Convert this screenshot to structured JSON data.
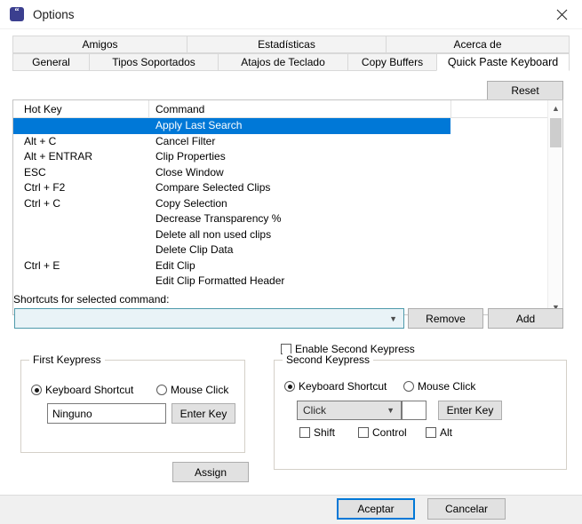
{
  "window": {
    "title": "Options",
    "icon": "app-quote-icon",
    "close_label": "✕"
  },
  "tabs": {
    "row1": [
      {
        "label": "Amigos",
        "selected": false
      },
      {
        "label": "Estadísticas",
        "selected": false
      },
      {
        "label": "Acerca de",
        "selected": false
      }
    ],
    "row2": [
      {
        "label": "General",
        "selected": false
      },
      {
        "label": "Tipos Soportados",
        "selected": false
      },
      {
        "label": "Atajos de Teclado",
        "selected": false
      },
      {
        "label": "Copy Buffers",
        "selected": false
      },
      {
        "label": "Quick Paste Keyboard",
        "selected": true
      }
    ]
  },
  "toolbar": {
    "reset_label": "Reset"
  },
  "list": {
    "columns": [
      "Hot Key",
      "Command"
    ],
    "rows": [
      {
        "hotkey": "",
        "command": "Apply Last Search",
        "selected": true
      },
      {
        "hotkey": "Alt + C",
        "command": "Cancel Filter",
        "selected": false
      },
      {
        "hotkey": "Alt + ENTRAR",
        "command": "Clip Properties",
        "selected": false
      },
      {
        "hotkey": "ESC",
        "command": "Close Window",
        "selected": false
      },
      {
        "hotkey": "Ctrl + F2",
        "command": "Compare Selected Clips",
        "selected": false
      },
      {
        "hotkey": "Ctrl + C",
        "command": "Copy Selection",
        "selected": false
      },
      {
        "hotkey": "",
        "command": "Decrease Transparency %",
        "selected": false
      },
      {
        "hotkey": "",
        "command": "Delete all non used clips",
        "selected": false
      },
      {
        "hotkey": "",
        "command": "Delete Clip Data",
        "selected": false
      },
      {
        "hotkey": "Ctrl + E",
        "command": "Edit Clip",
        "selected": false
      },
      {
        "hotkey": "",
        "command": "Edit Clip Formatted Header",
        "selected": false
      }
    ]
  },
  "shortcuts": {
    "label": "Shortcuts for selected command:",
    "combo_value": "",
    "remove_label": "Remove",
    "add_label": "Add"
  },
  "enable_second": {
    "label": "Enable Second Keypress",
    "checked": false
  },
  "first_keypress": {
    "title": "First Keypress",
    "keyboard_label": "Keyboard Shortcut",
    "mouse_label": "Mouse Click",
    "selected_mode": "keyboard",
    "key_value": "Ninguno",
    "enter_key_label": "Enter Key"
  },
  "second_keypress": {
    "title": "Second Keypress",
    "keyboard_label": "Keyboard Shortcut",
    "mouse_label": "Mouse Click",
    "selected_mode": "keyboard",
    "combo_value": "Click",
    "extra_value": "",
    "enter_key_label": "Enter Key",
    "modifiers": [
      {
        "label": "Shift",
        "checked": false
      },
      {
        "label": "Control",
        "checked": false
      },
      {
        "label": "Alt",
        "checked": false
      }
    ]
  },
  "assign": {
    "label": "Assign"
  },
  "footer": {
    "accept_label": "Aceptar",
    "cancel_label": "Cancelar"
  },
  "colors": {
    "selection": "#0078d7",
    "accent_border": "#0078d7",
    "combo_border": "#4e9aab",
    "dialog_bg": "#ffffff"
  }
}
